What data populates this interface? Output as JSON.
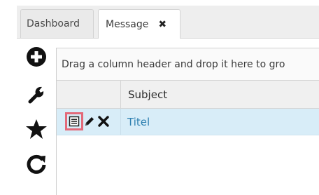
{
  "tabs": [
    {
      "label": "Dashboard",
      "active": false
    },
    {
      "label": "Message",
      "active": true,
      "close_symbol": "✖"
    }
  ],
  "toolbar": {
    "buttons": [
      {
        "icon": "add-circle-icon",
        "color": "#111111"
      },
      {
        "icon": "wrench-icon",
        "color": "#111111"
      },
      {
        "icon": "star-icon",
        "color": "#111111"
      },
      {
        "icon": "refresh-icon",
        "color": "#111111"
      }
    ]
  },
  "grid": {
    "group_panel_text": "Drag a column header and drop it here to gro",
    "columns": [
      {
        "header": ""
      },
      {
        "header": "Subject"
      }
    ],
    "rows": [
      {
        "subject": "Titel",
        "commands": [
          "details-icon",
          "edit-pencil-icon",
          "delete-x-icon"
        ],
        "selected": true
      }
    ]
  },
  "colors": {
    "selected_row": "#d8edf8",
    "subject_link": "#2c7fb0",
    "highlight_border": "#e36a7a",
    "tab_strip": "#eeeeee"
  }
}
